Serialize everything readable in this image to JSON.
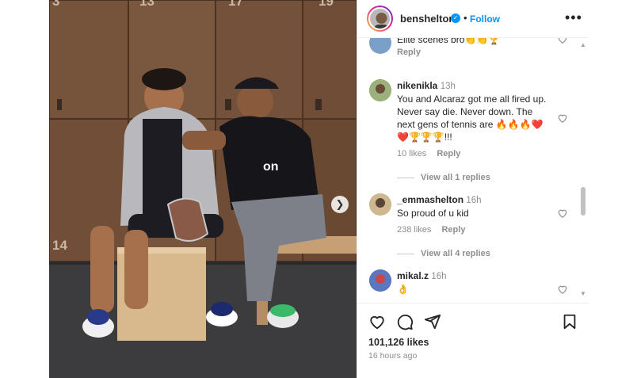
{
  "photo": {
    "locker_numbers": [
      "3",
      "13",
      "17",
      "19",
      "14"
    ],
    "shirt_logo": "on",
    "carousel_next_icon": "chevron-right-icon"
  },
  "post_header": {
    "username": "benshelton",
    "verified_icon": "verified-badge-icon",
    "separator": "•",
    "follow_label": "Follow",
    "more_icon": "more-options-icon",
    "accent": "#0095f6"
  },
  "comments": [
    {
      "text": "Elite scenes bro👏👏🏆",
      "reply_label": "Reply"
    },
    {
      "username": "nikenikla",
      "time": "13h",
      "text": "You and Alcaraz got me all fired up. Never say die. Never down. The next gens of tennis are 🔥🔥🔥❤️ ❤️🏆🏆🏆!!!",
      "likes": "10 likes",
      "reply_label": "Reply",
      "view_replies": "View all 1 replies"
    },
    {
      "username": "_emmashelton",
      "time": "16h",
      "text": "So proud of u kid",
      "likes": "238 likes",
      "reply_label": "Reply",
      "view_replies": "View all 4 replies"
    },
    {
      "username": "mikal.z",
      "time": "16h",
      "text": "👌"
    }
  ],
  "actions": {
    "like_icon": "heart-icon",
    "comment_icon": "comment-icon",
    "share_icon": "share-icon",
    "save_icon": "bookmark-icon",
    "likes_count": "101,126 likes",
    "posted_ago": "16 hours ago"
  }
}
